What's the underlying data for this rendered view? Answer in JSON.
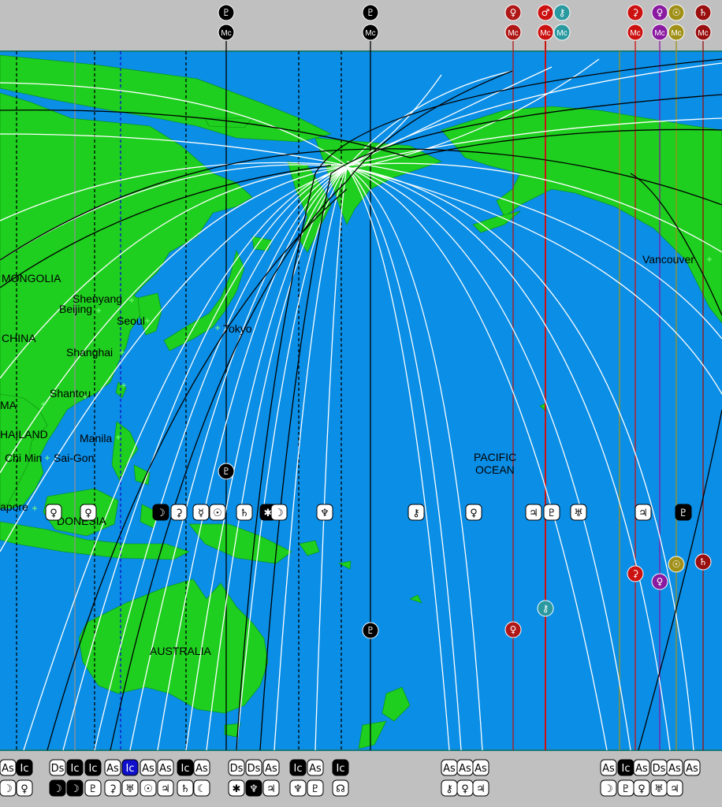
{
  "colors": {
    "ocean": "#0b8ee6",
    "land": "#1fcf1f",
    "strip": "#c0c0c0",
    "line_white": "#ffffff",
    "line_black": "#000000",
    "mars_red": "#cc1111",
    "venus_red": "#b01818",
    "purple": "#8a1aa0",
    "olive": "#a09018",
    "teal": "#2a9aa0",
    "saturn_red": "#9a1010",
    "blue": "#1010cc",
    "gray": "#909090"
  },
  "places": [
    {
      "name": "MONGOLIA"
    },
    {
      "name": "Shenyang"
    },
    {
      "name": "Beijing"
    },
    {
      "name": "Seoul"
    },
    {
      "name": "CHINA"
    },
    {
      "name": "Tokyo"
    },
    {
      "name": "Shanghai"
    },
    {
      "name": "Shantou"
    },
    {
      "name": "MA"
    },
    {
      "name": "HAILAND"
    },
    {
      "name": "Manila"
    },
    {
      "name": "Chi Min"
    },
    {
      "name": "Sai-Gon"
    },
    {
      "name": "apore"
    },
    {
      "name": "DONESIA"
    },
    {
      "name": "PACIFIC"
    },
    {
      "name": "OCEAN"
    },
    {
      "name": "AUSTRALIA"
    },
    {
      "name": "Vancouver"
    }
  ],
  "top_markers": [
    {
      "planet": "pluto-icon",
      "glyph": "♇",
      "angle": "Mc",
      "color": "#000000"
    },
    {
      "planet": "pluto-icon",
      "glyph": "♇",
      "angle": "Mc",
      "color": "#000000"
    },
    {
      "planet": "venus-icon",
      "glyph": "♀",
      "angle": "Mc",
      "color": "#b01818"
    },
    {
      "planet": "mars-icon",
      "glyph": "♂",
      "angle": "Mc",
      "color": "#cc1111"
    },
    {
      "planet": "chiron-icon",
      "glyph": "⚷",
      "angle": "Mc",
      "color": "#2a9aa0"
    },
    {
      "planet": "ceres-icon",
      "glyph": "⚳",
      "angle": "Mc",
      "color": "#cc1111"
    },
    {
      "planet": "venus-icon",
      "glyph": "♀",
      "angle": "Mc",
      "color": "#8a1aa0"
    },
    {
      "planet": "sun-icon",
      "glyph": "☉",
      "angle": "Mc",
      "color": "#a09018"
    },
    {
      "planet": "saturn-icon",
      "glyph": "♄",
      "angle": "Mc",
      "color": "#9a1010"
    }
  ],
  "mid_markers": [
    {
      "glyph": "♀"
    },
    {
      "glyph": "♀"
    },
    {
      "glyph": "☽"
    },
    {
      "glyph": "⚳"
    },
    {
      "glyph": "☿"
    },
    {
      "glyph": "☉"
    },
    {
      "glyph": "♄"
    },
    {
      "glyph": "✱"
    },
    {
      "glyph": "☽"
    },
    {
      "glyph": "♆"
    },
    {
      "glyph": "⚷"
    },
    {
      "glyph": "♀"
    },
    {
      "glyph": "♃"
    },
    {
      "glyph": "♇"
    },
    {
      "glyph": "♅"
    },
    {
      "glyph": "♃"
    },
    {
      "glyph": "♇"
    }
  ],
  "bottom_row1": [
    "As",
    "Ic",
    "Ds",
    "Ic",
    "Ic",
    "As",
    "Ic",
    "As",
    "As",
    "Ic",
    "As",
    "Ds",
    "Ds",
    "As",
    "Ic",
    "As",
    "Ic",
    "As",
    "As",
    "As",
    "As",
    "Ic",
    "As",
    "Ds",
    "As",
    "As"
  ],
  "bottom_row2": [
    "☽",
    "♀",
    "☽",
    "☽",
    "♇",
    "⚳",
    "♅",
    "☉",
    "♃",
    "♄",
    "☾",
    "✱",
    "♆",
    "♃",
    "♆",
    "♇",
    "☊",
    "⚷",
    "♀",
    "♃",
    "☽",
    "♇",
    "♀",
    "♅",
    "♃"
  ]
}
